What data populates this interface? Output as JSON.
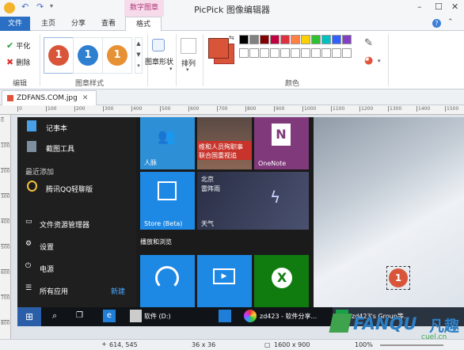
{
  "app": {
    "title": "PicPick 图像编辑器",
    "context_tab": "数字图章"
  },
  "tabs": [
    "文件",
    "主页",
    "分享",
    "查看",
    "格式"
  ],
  "ribbon": {
    "edit_group": {
      "label": "编辑",
      "flat": "平化",
      "delete": "删除"
    },
    "stamp_style_group": {
      "label": "图章样式",
      "number": "1",
      "colors": [
        "#d9553a",
        "#2f7fd1",
        "#e69133"
      ]
    },
    "shape": {
      "label": "图章形状"
    },
    "arrange": {
      "label": "排列"
    },
    "color_group": {
      "label": "颜色",
      "primary": "#d9553a",
      "palette": [
        "#000000",
        "#808080",
        "#800000",
        "#c00040",
        "#e03040",
        "#ff8040",
        "#ffd000",
        "#30c030",
        "#00c0c0",
        "#3060ff",
        "#8040c0",
        "#ffffff",
        "#ffffff",
        "#ffffff",
        "#ffffff",
        "#ffffff",
        "#ffffff",
        "#ffffff",
        "#ffffff",
        "#ffffff",
        "#ffffff",
        "#ffffff"
      ]
    }
  },
  "document": {
    "tab_name": "ZDFANS.COM.jpg"
  },
  "ruler": {
    "ticks": [
      "0",
      "100",
      "200",
      "300",
      "400",
      "500",
      "600",
      "700",
      "800",
      "900",
      "1000",
      "1100",
      "1200",
      "1300",
      "1400",
      "1500"
    ]
  },
  "vruler": {
    "ticks": [
      "0",
      "100",
      "200",
      "300",
      "400",
      "500",
      "600",
      "700",
      "800"
    ]
  },
  "canvas": {
    "start_menu": {
      "items": [
        "记事本",
        "截图工具",
        "最近添加",
        "腾讯QQ轻聊版",
        "文件资源管理器",
        "设置",
        "电源",
        "所有应用",
        "新建"
      ]
    },
    "tiles": {
      "people": "人脉",
      "news": "维和人员殉职事 联合国重视追",
      "onenote": "OneNote",
      "store": "Store (Beta)",
      "weather_city": "北京",
      "weather_cond": "雷阵雨",
      "weather": "天气",
      "section": "播放和浏览"
    },
    "stamp_number": "1",
    "taskbar": {
      "drive": "软件 (D:)",
      "item2": "zd423 - 软件分享...",
      "item3": "zd423's Group等..."
    }
  },
  "status": {
    "coords": "614, 545",
    "size": "36 x 36",
    "image_size": "1600 x 900",
    "zoom": "100%"
  },
  "watermark": {
    "brand": "FANQU",
    "cn": "凡趣",
    "domain": "cuel.cn"
  }
}
